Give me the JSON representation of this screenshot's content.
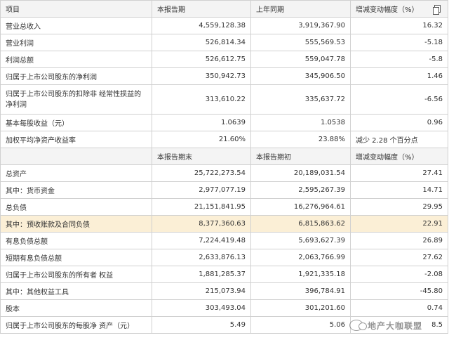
{
  "header1": {
    "item": "项目",
    "current": "本报告期",
    "previous": "上年同期",
    "change": "增减变动幅度（%）"
  },
  "group1": [
    {
      "label": "营业总收入",
      "current": "4,559,128.38",
      "previous": "3,919,367.90",
      "change": "16.32"
    },
    {
      "label": "营业利润",
      "current": "526,814.34",
      "previous": "555,569.53",
      "change": "-5.18"
    },
    {
      "label": "利润总额",
      "current": "526,612.75",
      "previous": "559,047.78",
      "change": "-5.8"
    },
    {
      "label": "归属于上市公司股东的净利润",
      "current": "350,942.73",
      "previous": "345,906.50",
      "change": "1.46"
    },
    {
      "label": "归属于上市公司股东的扣除非 经常性损益的净利润",
      "current": "313,610.22",
      "previous": "335,637.72",
      "change": "-6.56"
    },
    {
      "label": "基本每股收益（元）",
      "current": "1.0639",
      "previous": "1.0538",
      "change": "0.96"
    },
    {
      "label": "加权平均净资产收益率",
      "current": "21.60%",
      "previous": "23.88%",
      "change": "减少 2.28 个百分点"
    }
  ],
  "header2": {
    "item": "",
    "current": "本报告期末",
    "previous": "本报告期初",
    "change": "增减变动幅度（%）"
  },
  "group2": [
    {
      "label": "总资产",
      "current": "25,722,273.54",
      "previous": "20,189,031.54",
      "change": "27.41"
    },
    {
      "label": "其中：货币资金",
      "current": "2,977,077.19",
      "previous": "2,595,267.39",
      "change": "14.71"
    },
    {
      "label": "总负债",
      "current": "21,151,841.95",
      "previous": "16,276,964.61",
      "change": "29.95"
    },
    {
      "label": "其中：预收账款及合同负债",
      "current": "8,377,360.63",
      "previous": "6,815,863.62",
      "change": "22.91"
    },
    {
      "label": "有息负债总额",
      "current": "7,224,419.48",
      "previous": "5,693,627.39",
      "change": "26.89"
    },
    {
      "label": "短期有息负债总额",
      "current": "2,633,876.13",
      "previous": "2,063,766.99",
      "change": "27.62"
    },
    {
      "label": "归属于上市公司股东的所有者 权益",
      "current": "1,881,285.37",
      "previous": "1,921,335.18",
      "change": "-2.08"
    },
    {
      "label": "其中：其他权益工具",
      "current": "215,073.94",
      "previous": "396,784.91",
      "change": "-45.80"
    },
    {
      "label": "股本",
      "current": "303,493.04",
      "previous": "301,201.60",
      "change": "0.74"
    },
    {
      "label": "归属于上市公司股东的每股净 资产（元）",
      "current": "5.49",
      "previous": "5.06",
      "change": "8.5"
    }
  ],
  "watermark": {
    "text": "地产大咖联盟"
  },
  "colors": {
    "highlight_row": "#fbefd6",
    "border": "#d0d0d0"
  },
  "icons": {
    "header_corner": "copy-icon",
    "watermark": "wechat-icon"
  }
}
